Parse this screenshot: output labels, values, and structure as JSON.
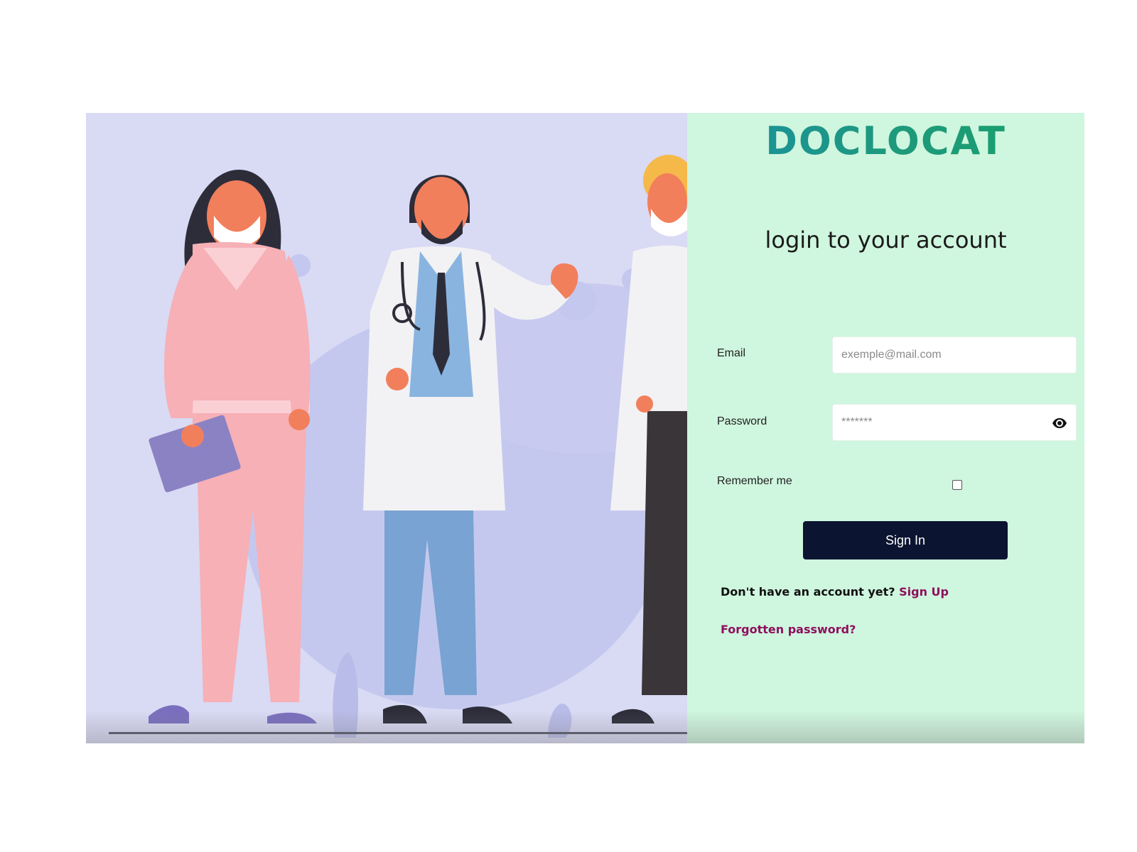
{
  "brand": {
    "name": "DOCLOCAT"
  },
  "login": {
    "heading": "login to your account",
    "email_label": "Email",
    "email_placeholder": "exemple@mail.com",
    "password_label": "Password",
    "password_placeholder": "*******",
    "remember_label": "Remember me",
    "remember_checked": false,
    "signin_label": "Sign In",
    "no_account_text": "Don't have an account yet?",
    "signup_link": "Sign Up",
    "forgot_link": "Forgotten password?"
  },
  "icons": [
    "eye-icon"
  ],
  "colors": {
    "illustration_bg": "#d9daf4",
    "panel_bg": "#cff6de",
    "button_bg": "#0b1430",
    "link": "#8e0f5d",
    "logo_teal": "#1b8fa3",
    "logo_green": "#17a06a"
  }
}
